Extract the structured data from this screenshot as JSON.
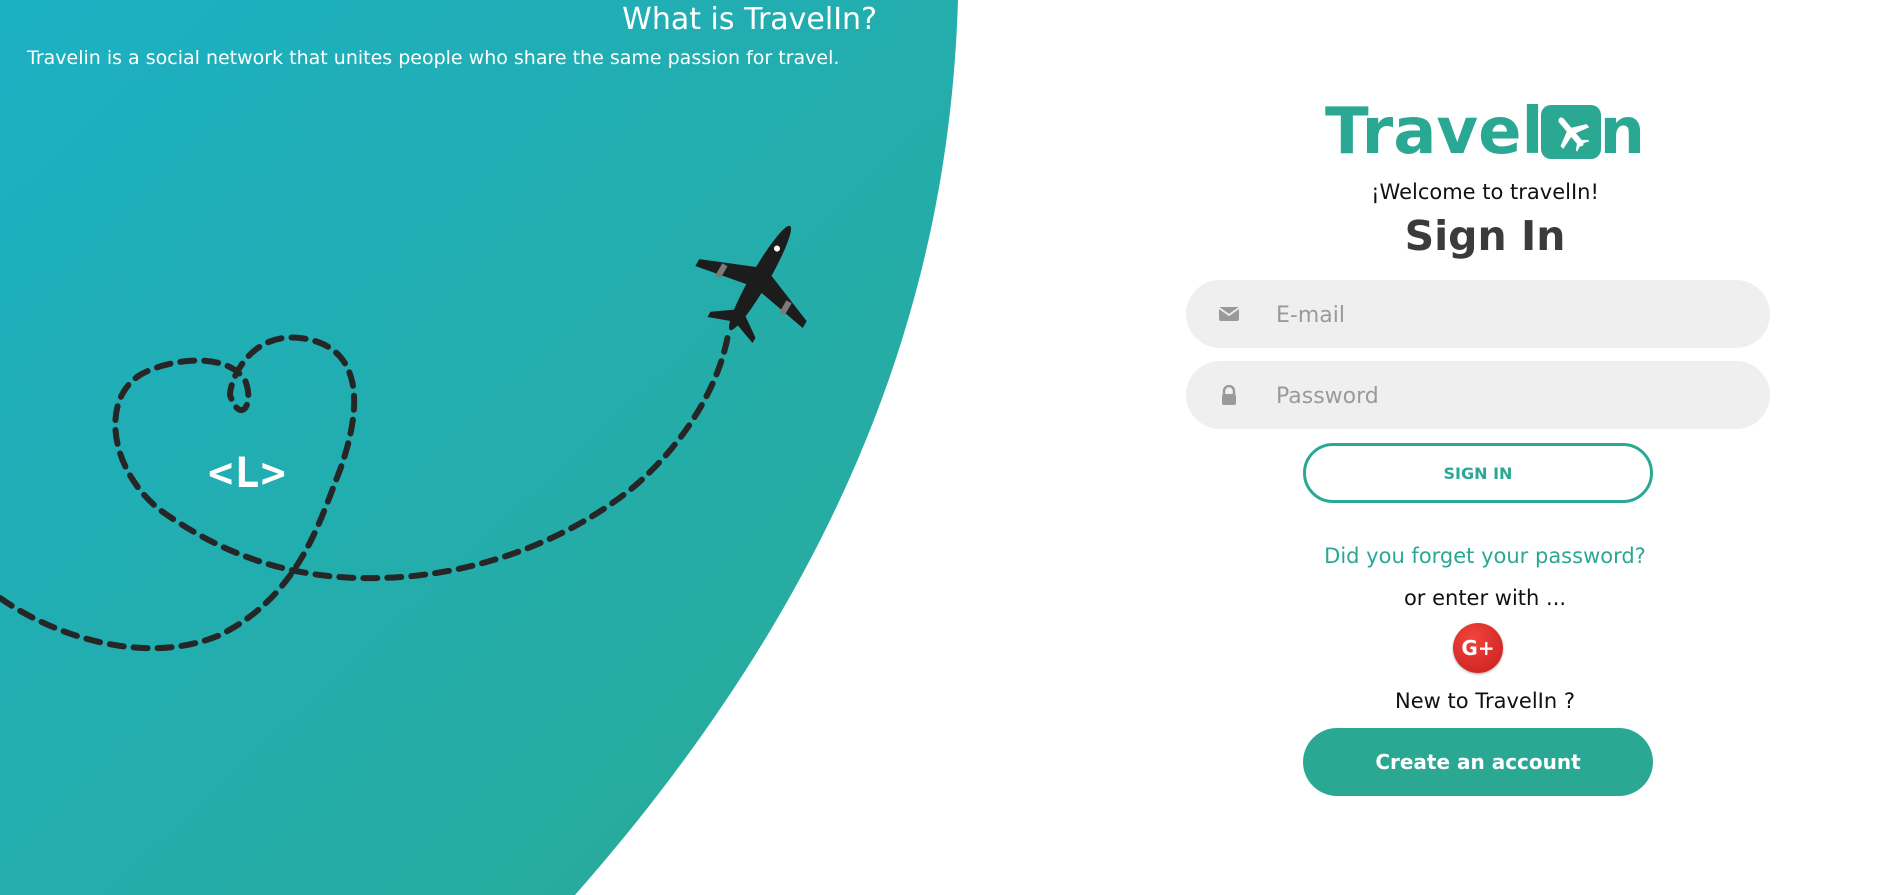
{
  "hero": {
    "title": "What is TravelIn?",
    "description": "Travelin is a social network that unites people who share the same passion for travel.",
    "code_mark": "<L>",
    "gradient_start": "#1cb0c4",
    "gradient_end": "#2aaa95"
  },
  "login": {
    "logo_left": "Travel",
    "logo_right": "n",
    "welcome": "¡Welcome to travelIn!",
    "title": "Sign In",
    "email_placeholder": "E-mail",
    "password_placeholder": "Password",
    "signin_label": "SIGN IN",
    "forgot_label": "Did you forget your password?",
    "or_enter": "or enter with ...",
    "social_label": "G+",
    "new_to": "New to TravelIn ?",
    "create_label": "Create an account",
    "accent": "#2aa894"
  },
  "icons": {
    "email": "envelope-icon",
    "password": "lock-icon",
    "social": "google-plus-icon",
    "logo": "airplane-icon"
  }
}
